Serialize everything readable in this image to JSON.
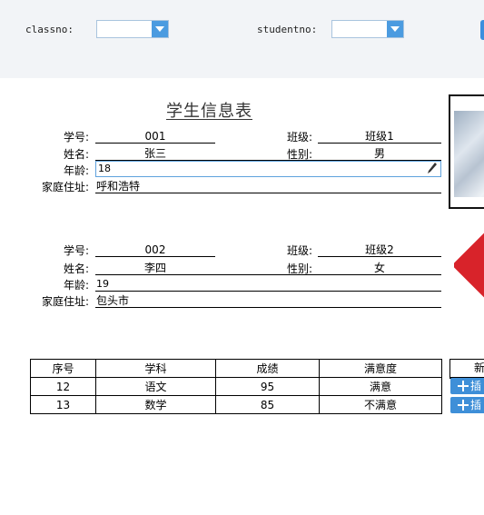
{
  "filters": {
    "classno_label": "classno:",
    "classno_value": "",
    "studentno_label": "studentno:",
    "studentno_value": ""
  },
  "form": {
    "title": "学生信息表",
    "labels": {
      "student_no": "学号:",
      "name": "姓名:",
      "age": "年龄:",
      "address": "家庭住址:",
      "class": "班级:",
      "gender": "性别:"
    }
  },
  "students": [
    {
      "student_no": "001",
      "name": "张三",
      "class": "班级1",
      "gender": "男",
      "age": "18",
      "address": "呼和浩特"
    },
    {
      "student_no": "002",
      "name": "李四",
      "class": "班级2",
      "gender": "女",
      "age": "19",
      "address": "包头市"
    }
  ],
  "grades": {
    "headers": [
      "序号",
      "学科",
      "成绩",
      "满意度"
    ],
    "rows": [
      [
        "12",
        "语文",
        "95",
        "满意"
      ],
      [
        "13",
        "数学",
        "85",
        "不满意"
      ]
    ]
  },
  "side_panel": {
    "header": "新",
    "buttons": [
      "插",
      "插"
    ]
  },
  "colors": {
    "accent": "#3e8fd8",
    "filterbar": "#f2f4f7",
    "stamp": "#d8232a"
  },
  "icons": {
    "dropdown": "chevron-down-icon",
    "edit": "pencil-icon",
    "add": "plus-icon"
  }
}
